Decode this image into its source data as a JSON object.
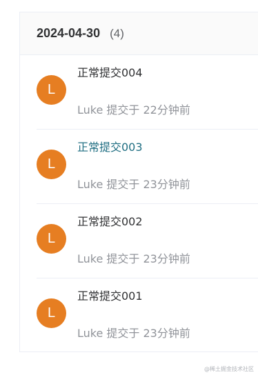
{
  "group": {
    "date": "2024-04-30",
    "count": "(4)"
  },
  "commits": [
    {
      "avatar_letter": "L",
      "title": "正常提交004",
      "meta": "Luke 提交于 22分钟前"
    },
    {
      "avatar_letter": "L",
      "title": "正常提交003",
      "meta": "Luke 提交于 23分钟前"
    },
    {
      "avatar_letter": "L",
      "title": "正常提交002",
      "meta": "Luke 提交于 23分钟前"
    },
    {
      "avatar_letter": "L",
      "title": "正常提交001",
      "meta": "Luke 提交于 23分钟前"
    }
  ],
  "colors": {
    "avatar_bg": "#e67e22",
    "active_title": "#1f6e82"
  },
  "watermark": "@稀土掘金技术社区"
}
